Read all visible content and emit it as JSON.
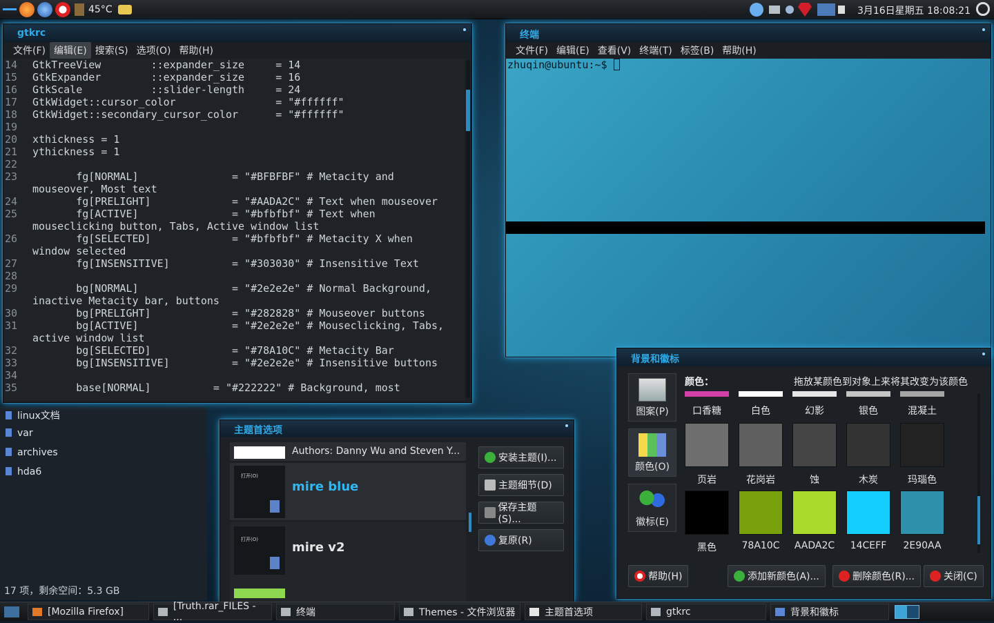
{
  "top_panel": {
    "temperature": "45°C",
    "clock": "3月16日星期五 18:08:21"
  },
  "gtkrc_window": {
    "title": "gtkrc",
    "menu": [
      "文件(F)",
      "编辑(E)",
      "搜索(S)",
      "选项(O)",
      "帮助(H)"
    ],
    "lines": [
      {
        "n": "14",
        "t": "GtkTreeView        ::expander_size     = 14"
      },
      {
        "n": "15",
        "t": "GtkExpander        ::expander_size     = 16"
      },
      {
        "n": "16",
        "t": "GtkScale           ::slider-length     = 24"
      },
      {
        "n": "17",
        "t": "GtkWidget::cursor_color                = \"#ffffff\""
      },
      {
        "n": "18",
        "t": "GtkWidget::secondary_cursor_color      = \"#ffffff\""
      },
      {
        "n": "19",
        "t": ""
      },
      {
        "n": "20",
        "t": "xthickness = 1"
      },
      {
        "n": "21",
        "t": "ythickness = 1"
      },
      {
        "n": "22",
        "t": ""
      },
      {
        "n": "23",
        "t": "       fg[NORMAL]               = \"#BFBFBF\" # Metacity and"
      },
      {
        "n": "",
        "t": "mouseover, Most text"
      },
      {
        "n": "24",
        "t": "       fg[PRELIGHT]             = \"#AADA2C\" # Text when mouseover"
      },
      {
        "n": "25",
        "t": "       fg[ACTIVE]               = \"#bfbfbf\" # Text when"
      },
      {
        "n": "",
        "t": "mouseclicking button, Tabs, Active window list"
      },
      {
        "n": "26",
        "t": "       fg[SELECTED]             = \"#bfbfbf\" # Metacity X when"
      },
      {
        "n": "",
        "t": "window selected"
      },
      {
        "n": "27",
        "t": "       fg[INSENSITIVE]          = \"#303030\" # Insensitive Text"
      },
      {
        "n": "28",
        "t": ""
      },
      {
        "n": "29",
        "t": "       bg[NORMAL]               = \"#2e2e2e\" # Normal Background,"
      },
      {
        "n": "",
        "t": "inactive Metacity bar, buttons"
      },
      {
        "n": "30",
        "t": "       bg[PRELIGHT]             = \"#282828\" # Mouseover buttons"
      },
      {
        "n": "31",
        "t": "       bg[ACTIVE]               = \"#2e2e2e\" # Mouseclicking, Tabs,"
      },
      {
        "n": "",
        "t": "active window list"
      },
      {
        "n": "32",
        "t": "       bg[SELECTED]             = \"#78A10C\" # Metacity Bar"
      },
      {
        "n": "33",
        "t": "       bg[INSENSITIVE]          = \"#2e2e2e\" # Insensitive buttons"
      },
      {
        "n": "34",
        "t": ""
      },
      {
        "n": "35",
        "t": "       base[NORMAL]          = \"#222222\" # Background, most"
      }
    ]
  },
  "file_list": {
    "items": [
      "linux文档",
      "var",
      "archives",
      "hda6"
    ],
    "status": "17 项，剩余空间：5.3 GB"
  },
  "terminal": {
    "title": "终端",
    "menu": [
      "文件(F)",
      "编辑(E)",
      "查看(V)",
      "终端(T)",
      "标签(B)",
      "帮助(H)"
    ],
    "prompt": "zhuqin@ubuntu:~$ "
  },
  "bg_emblems": {
    "title": "背景和徽标",
    "categories": [
      "图案(P)",
      "颜色(O)",
      "徽标(E)"
    ],
    "color_label": "颜色：",
    "hint": "拖放某颜色到对象上来将其改变为该颜色",
    "row1": [
      {
        "name": "口香糖",
        "color": "#d33fa6"
      },
      {
        "name": "白色",
        "color": "#ffffff"
      },
      {
        "name": "幻影",
        "color": "#e6e6e6"
      },
      {
        "name": "银色",
        "color": "#c4c4c4"
      },
      {
        "name": "混凝土",
        "color": "#a6a6a6"
      }
    ],
    "row2": [
      {
        "name": "页岩",
        "color": "#6e6e6e"
      },
      {
        "name": "花岗岩",
        "color": "#5f5f5f"
      },
      {
        "name": "蚀",
        "color": "#454545"
      },
      {
        "name": "木炭",
        "color": "#333333"
      },
      {
        "name": "玛瑙色",
        "color": "#222222"
      }
    ],
    "row3": [
      {
        "name": "黑色",
        "color": "#000000"
      },
      {
        "name": "78A10C",
        "color": "#78A10C"
      },
      {
        "name": "AADA2C",
        "color": "#AADA2C"
      },
      {
        "name": "14CEFF",
        "color": "#14CEFF"
      },
      {
        "name": "2E90AA",
        "color": "#2E90AA"
      }
    ],
    "buttons": {
      "help": "帮助(H)",
      "add": "添加新颜色(A)...",
      "remove": "删除颜色(R)...",
      "close": "关闭(C)"
    }
  },
  "theme_prefs": {
    "title": "主题首选项",
    "items": [
      {
        "label": "Authors: Danny Wu and Steven Y..."
      },
      {
        "label": "mire blue"
      },
      {
        "label": "mire v2"
      }
    ],
    "thumb_text": "打开(O)",
    "buttons": {
      "install": "安装主题(I)...",
      "details": "主题细节(D)",
      "save": "保存主题(S)...",
      "revert": "复原(R)"
    }
  },
  "taskbar": {
    "items": [
      "[Mozilla Firefox]",
      "[Truth.rar_FILES - ...",
      "终端",
      "Themes - 文件浏览器",
      "主题首选项",
      "gtkrc",
      "背景和徽标"
    ]
  }
}
